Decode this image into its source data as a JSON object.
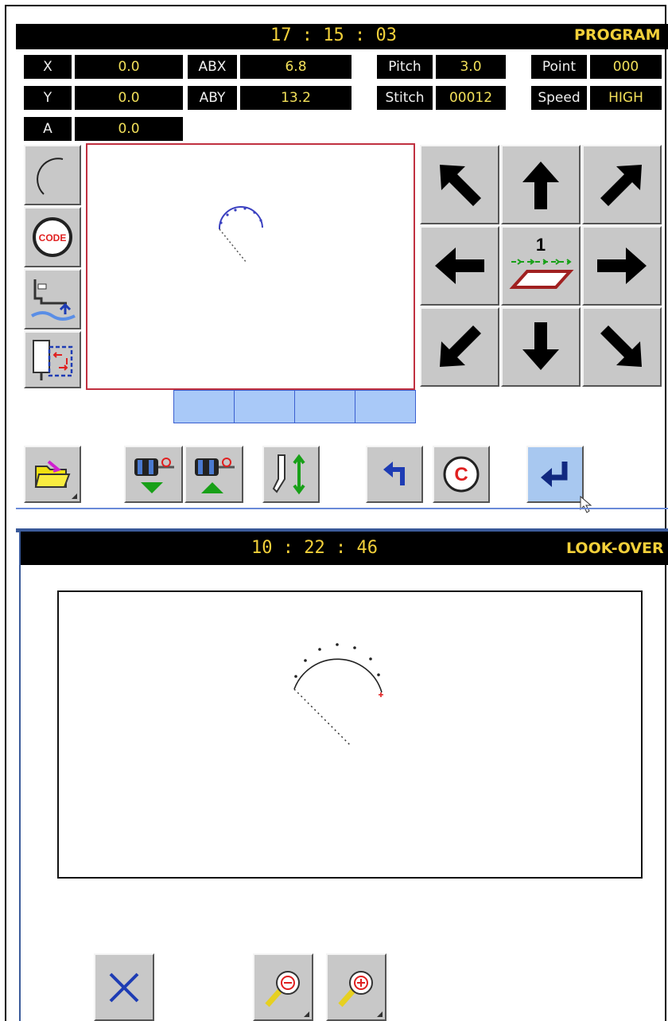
{
  "program_screen": {
    "time": "17 : 15 : 03",
    "mode": "PROGRAM",
    "fields": {
      "x": {
        "label": "X",
        "value": "0.0"
      },
      "y": {
        "label": "Y",
        "value": "0.0"
      },
      "a": {
        "label": "A",
        "value": "0.0"
      },
      "abx": {
        "label": "ABX",
        "value": "6.8"
      },
      "aby": {
        "label": "ABY",
        "value": "13.2"
      },
      "pitch": {
        "label": "Pitch",
        "value": "3.0"
      },
      "stitch": {
        "label": "Stitch",
        "value": "00012"
      },
      "point": {
        "label": "Point",
        "value": "000"
      },
      "speed": {
        "label": "Speed",
        "value": "HIGH"
      }
    },
    "tool_icons": [
      "arc-icon",
      "code-icon",
      "presser-foot-icon",
      "needle-position-icon"
    ],
    "jog_step_label": "1",
    "jog_icons": [
      "arrow-up-left-icon",
      "arrow-up-icon",
      "arrow-up-right-icon",
      "arrow-left-icon",
      "jog-step-icon",
      "arrow-right-icon",
      "arrow-down-left-icon",
      "arrow-down-icon",
      "arrow-down-right-icon"
    ],
    "code_label": "CODE",
    "clear_label": "C",
    "bottom_icons": [
      "folder-open-icon",
      "bobbin-down-icon",
      "bobbin-up-icon",
      "presser-height-icon",
      "undo-icon",
      "clear-icon",
      "enter-icon"
    ],
    "colors": {
      "header_bg": "#000000",
      "time_text": "#f2d03a",
      "value_text": "#f2e05a",
      "button_face": "#c8c8c8",
      "tab_fill": "#a9c9f8",
      "enter_face": "#a8c8f0",
      "canvas_border": "#c03040"
    }
  },
  "lookover_screen": {
    "time": "10 : 22 : 46",
    "mode": "LOOK-OVER",
    "bottom_icons": [
      "close-icon",
      "zoom-out-icon",
      "zoom-in-icon"
    ]
  }
}
